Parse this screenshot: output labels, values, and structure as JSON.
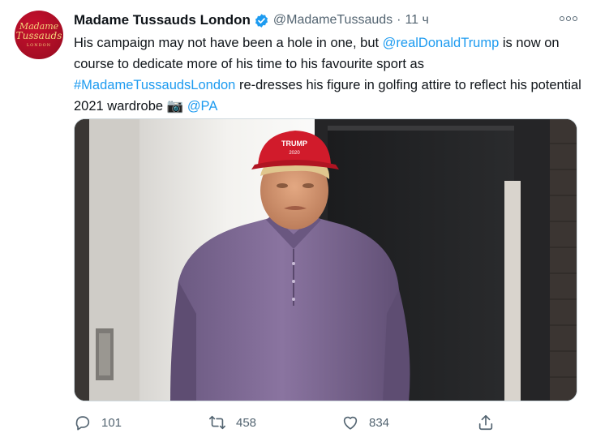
{
  "tweet": {
    "avatar": {
      "line1": "Madame",
      "line2": "Tussauds",
      "line3": "LONDON"
    },
    "author_name": "Madame Tussauds London",
    "handle": "@MadameTussauds",
    "separator": "·",
    "time": "11 ч",
    "text": {
      "part1": "His campaign may not have been a hole in one, but ",
      "mention1": "@realDonaldTrump",
      "part2": " is now on course to dedicate more of his time to his favourite sport as ",
      "hashtag": "#MadameTussaudsLondon",
      "part3": " re-dresses his figure in golfing attire to reflect his potential 2021 wardrobe ",
      "camera_emoji": "📷",
      "space": " ",
      "mention2": "@PA"
    },
    "media": {
      "cap_text_line1": "TRUMP",
      "cap_text_line2": "2020"
    },
    "actions": {
      "reply_count": "101",
      "retweet_count": "458",
      "like_count": "834"
    },
    "colors": {
      "link": "#1d9bf0",
      "secondary_text": "#536471",
      "verified": "#1d9bf0",
      "brand_red": "#c8102e"
    }
  }
}
